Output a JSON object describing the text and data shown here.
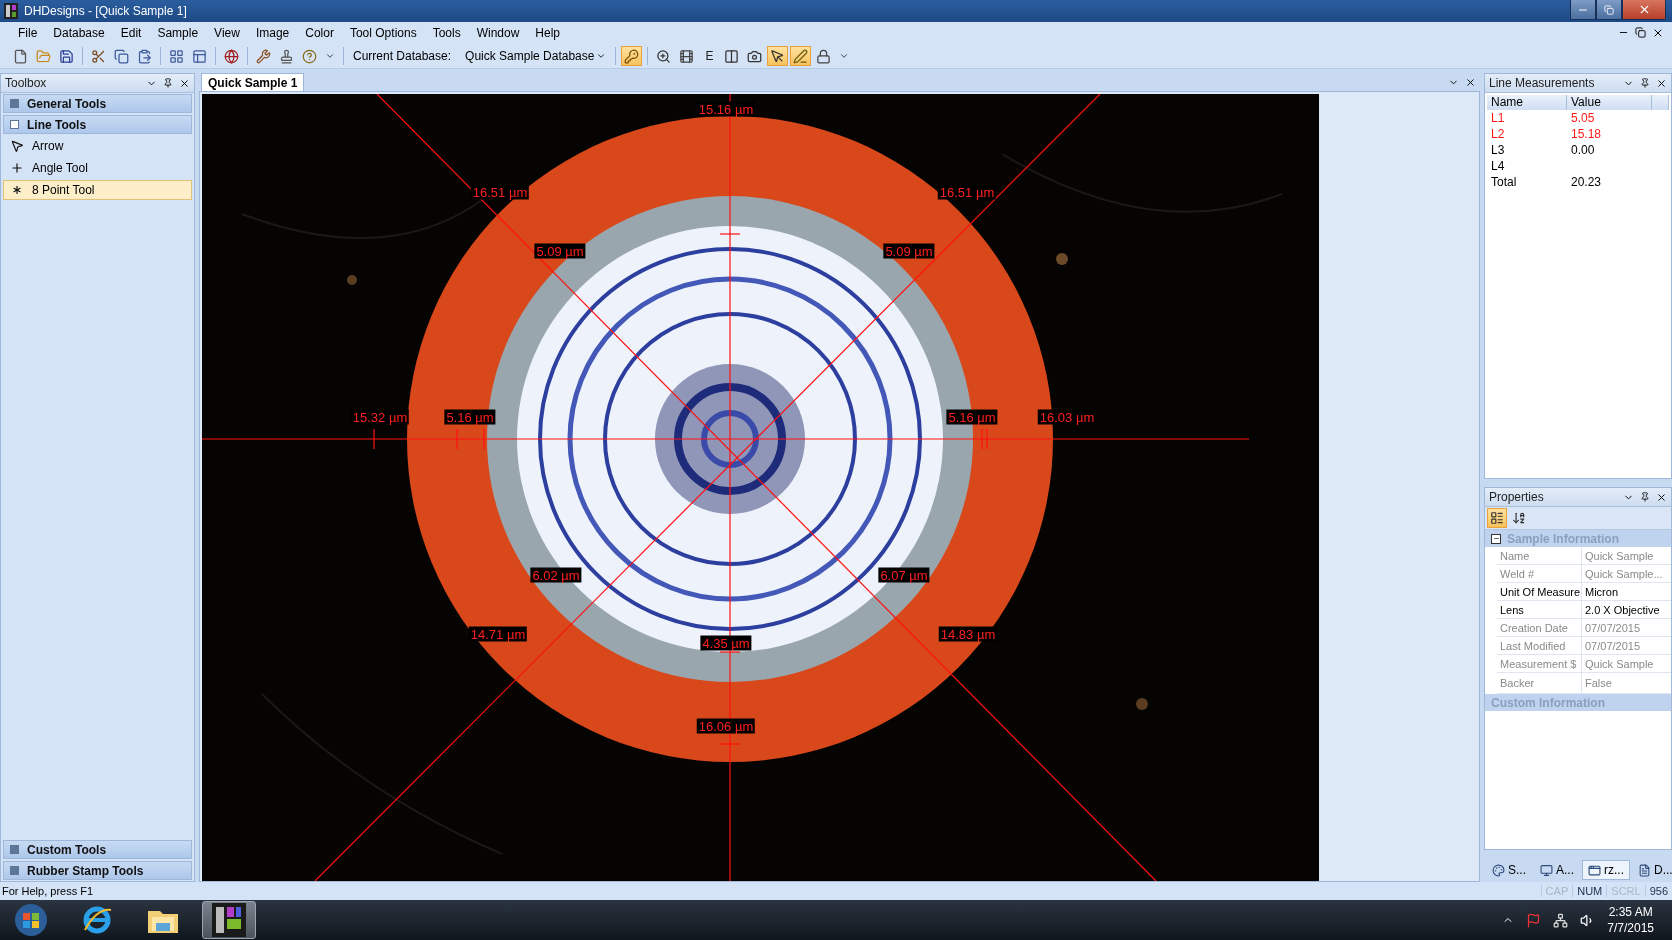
{
  "window": {
    "title": "DHDesigns - [Quick Sample 1]"
  },
  "menu": [
    "File",
    "Database",
    "Edit",
    "Sample",
    "View",
    "Image",
    "Color",
    "Tool Options",
    "Tools",
    "Window",
    "Help"
  ],
  "toolbar": {
    "buttons": [
      {
        "kind": "file",
        "on": false
      },
      {
        "kind": "folder",
        "on": false
      },
      {
        "kind": "save",
        "on": false
      },
      {
        "kind": "sep"
      },
      {
        "kind": "scissors",
        "on": false
      },
      {
        "kind": "copy",
        "on": false
      },
      {
        "kind": "paste",
        "on": false
      },
      {
        "kind": "sep"
      },
      {
        "kind": "grid",
        "on": false
      },
      {
        "kind": "window",
        "on": false
      },
      {
        "kind": "sep"
      },
      {
        "kind": "globe",
        "on": false
      },
      {
        "kind": "sep"
      },
      {
        "kind": "tools",
        "on": false
      },
      {
        "kind": "stamp",
        "on": false
      },
      {
        "kind": "help",
        "on": false
      },
      {
        "kind": "caret",
        "on": false
      }
    ],
    "database_label": "Current Database:",
    "database_value": "Quick Sample Database",
    "buttons_right": [
      {
        "kind": "key",
        "on": true
      },
      {
        "kind": "sep"
      },
      {
        "kind": "zoom",
        "on": false
      },
      {
        "kind": "film",
        "on": false
      },
      {
        "kind": "text",
        "label": "E",
        "on": false
      },
      {
        "kind": "columns",
        "on": false
      },
      {
        "kind": "camera",
        "on": false
      },
      {
        "kind": "pointer",
        "on": true
      },
      {
        "kind": "pen",
        "on": true
      },
      {
        "kind": "lock",
        "on": false
      },
      {
        "kind": "caret",
        "on": false
      }
    ]
  },
  "toolbox": {
    "title": "Toolbox",
    "groups": [
      {
        "label": "General Tools",
        "expanded": false
      },
      {
        "label": "Line Tools",
        "expanded": true,
        "items": [
          {
            "kind": "arrow",
            "label": "Arrow",
            "selected": false
          },
          {
            "kind": "cross",
            "label": "Angle Tool",
            "selected": false
          },
          {
            "kind": "star",
            "label": "8 Point Tool",
            "selected": true
          }
        ]
      },
      {
        "label": "Custom Tools",
        "expanded": false
      },
      {
        "label": "Rubber Stamp Tools",
        "expanded": false
      }
    ]
  },
  "document": {
    "tabs": [
      {
        "label": "Quick Sample 1",
        "selected": true
      }
    ],
    "image_labels": [
      "15.16 µm",
      "16.51 µm",
      "16.51 µm",
      "5.09 µm",
      "5.09 µm",
      "15.32 µm",
      "5.16 µm",
      "5.16 µm",
      "16.03 µm",
      "6.02 µm",
      "6.07 µm",
      "14.71 µm",
      "14.83 µm",
      "4.35 µm",
      "16.06 µm"
    ]
  },
  "line_measurements": {
    "title": "Line Measurements",
    "columns": [
      "Name",
      "Value"
    ],
    "rows": [
      {
        "name": "L1",
        "value": "5.05",
        "highlighted": true
      },
      {
        "name": "L2",
        "value": "15.18",
        "highlighted": true
      },
      {
        "name": "L3",
        "value": "0.00",
        "highlighted": false
      },
      {
        "name": "L4",
        "highlighted": false
      },
      {
        "name": "Total",
        "value": "20.23",
        "highlighted": false
      }
    ]
  },
  "properties": {
    "title": "Properties",
    "view_buttons": [
      {
        "kind": "categorized",
        "selected": true
      },
      {
        "kind": "alphabetical",
        "selected": false
      }
    ],
    "categories": [
      {
        "label": "Sample Information",
        "expanded": true,
        "rows": [
          {
            "name": "Name",
            "value": "Quick Sample",
            "read_only": true
          },
          {
            "name": "Weld #",
            "value": "Quick Sample...",
            "read_only": true
          },
          {
            "name": "Unit Of Measure",
            "value": "Micron",
            "read_only": false
          },
          {
            "name": "Lens",
            "value": "2.0 X Objective",
            "read_only": false
          },
          {
            "name": "Creation Date",
            "value": "07/07/2015",
            "read_only": true
          },
          {
            "name": "Last Modified",
            "value": "07/07/2015",
            "read_only": true
          },
          {
            "name": "Measurement $",
            "value": "Quick Sample",
            "read_only": true
          },
          {
            "name": "Backer",
            "value": "False",
            "read_only": true
          }
        ]
      },
      {
        "label": "Custom Information"
      }
    ]
  },
  "panel_tabs": [
    {
      "label": "S...",
      "kind": "palette",
      "selected": false
    },
    {
      "label": "A...",
      "kind": "monitor",
      "selected": false
    },
    {
      "label": "rz...",
      "kind": "windows",
      "selected": true
    },
    {
      "label": "D...",
      "kind": "doc",
      "selected": false
    }
  ],
  "status_bar": {
    "text": "For Help, press F1",
    "indicators": [
      {
        "label": "CAP",
        "on": false
      },
      {
        "label": "NUM",
        "on": true
      },
      {
        "label": "SCRL",
        "on": false
      },
      {
        "label": "956",
        "on": true
      }
    ]
  },
  "taskbar": {
    "buttons": [
      {
        "kind": "start",
        "active": false
      },
      {
        "kind": "browser",
        "active": false
      },
      {
        "kind": "folder",
        "active": false
      },
      {
        "kind": "app",
        "active": true
      }
    ],
    "time": "2:35 AM",
    "date": "7/7/2015"
  }
}
